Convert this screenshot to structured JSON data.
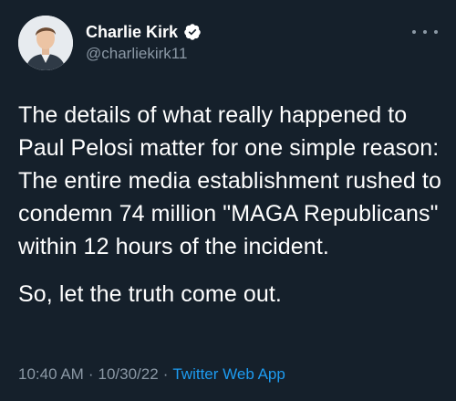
{
  "author": {
    "display_name": "Charlie Kirk",
    "handle": "@charliekirk11",
    "verified": true,
    "verified_color": "#1d9bf0"
  },
  "tweet": {
    "paragraphs": [
      "The details of what really happened to Paul Pelosi matter for one simple reason: The entire media establishment rushed to condemn 74 million \"MAGA Republicans\" within 12 hours of the incident.",
      "So, let the truth come out."
    ],
    "time": "10:40 AM",
    "separator": "·",
    "date": "10/30/22",
    "source": "Twitter Web App"
  },
  "icons": {
    "verified": "verified-badge-icon",
    "more": "more-options-icon"
  },
  "colors": {
    "background": "#15202b",
    "text": "#ffffff",
    "secondary": "#8b98a5",
    "accent": "#1d9bf0"
  }
}
